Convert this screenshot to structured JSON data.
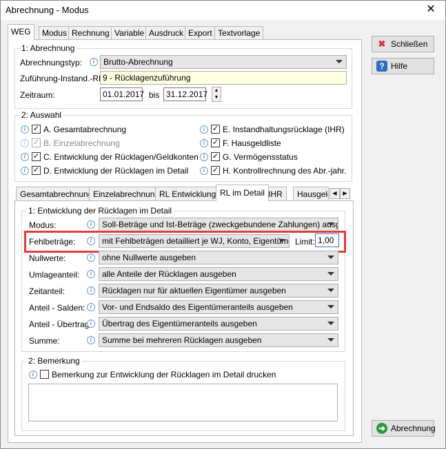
{
  "window": {
    "title": "Abrechnung - Modus",
    "close_glyph": "✕"
  },
  "main_tabs": [
    "WEG",
    "Modus",
    "Rechnung",
    "Variable",
    "Ausdruck",
    "Export",
    "Textvorlage"
  ],
  "group1": {
    "legend": "1: Abrechnung",
    "abrechnungstyp_label": "Abrechnungstyp:",
    "abrechnungstyp_value": "Brutto-Abrechnung",
    "zufuehrung_label": "Zuführung-Instand.-RL:",
    "zufuehrung_value": "9 - Rücklagenzuführung",
    "zeitraum_label": "Zeitraum:",
    "zeitraum_from": "01.01.2017",
    "zeitraum_bis": "bis",
    "zeitraum_to": "31.12.2017"
  },
  "group2": {
    "legend": "2: Auswahl",
    "items": [
      {
        "label": "A. Gesamtabrechnung",
        "checked": "✓"
      },
      {
        "label": "B. Einzelabrechnung",
        "checked": "✓"
      },
      {
        "label": "C. Entwicklung der Rücklagen/Geldkonten",
        "checked": "✓"
      },
      {
        "label": "D. Entwicklung der Rücklagen im Detail",
        "checked": "✓"
      },
      {
        "label": "E. Instandhaltungsrücklage (IHR)",
        "checked": "✓"
      },
      {
        "label": "F. Hausgeldliste",
        "checked": "✓"
      },
      {
        "label": "G. Vermögensstatus",
        "checked": "✓"
      },
      {
        "label": "H. Kontrollrechnung des Abr.-jahr.",
        "checked": "✓"
      }
    ]
  },
  "sub_tabs": [
    "Gesamtabrechnung",
    "Einzelabrechnung",
    "RL Entwicklung",
    "RL im Detail",
    "IHR",
    "Hausgeld"
  ],
  "detail": {
    "legend": "1: Entwicklung der Rücklagen im Detail",
    "rows": [
      {
        "label": "Modus:",
        "value": "Soll-Beträge und Ist-Beträge (zweckgebundene Zahlungen) ausgeben"
      },
      {
        "label": "Fehlbeträge:",
        "value": "mit Fehlbeträgen detailliert je WJ, Konto, Eigentümer"
      },
      {
        "label": "Nullwerte:",
        "value": "ohne Nullwerte ausgeben"
      },
      {
        "label": "Umlageanteil:",
        "value": "alle Anteile der Rücklagen ausgeben"
      },
      {
        "label": "Zeitanteil:",
        "value": "Rücklagen nur für aktuellen Eigentümer ausgeben"
      },
      {
        "label": "Anteil - Salden:",
        "value": "Vor- und Endsaldo des Eigentümeranteils ausgeben"
      },
      {
        "label": "Anteil - Übertrag:",
        "value": "Übertrag des Eigentümeranteils ausgeben"
      },
      {
        "label": "Summe:",
        "value": "Summe bei mehreren Rücklagen ausgeben"
      }
    ],
    "limit_label": "Limit:",
    "limit_value": "1,00"
  },
  "bemerkung": {
    "legend": "2: Bemerkung",
    "checkbox_label": "Bemerkung zur Entwicklung der Rücklagen im Detail drucken"
  },
  "buttons": {
    "schliessen": "Schließen",
    "hilfe": "Hilfe",
    "abrechnung": "Abrechnung"
  },
  "icons": {
    "info": "i",
    "close_button_icon": "✖",
    "help_button_icon": "?",
    "abrechnung_button_icon": "➜"
  },
  "colors": {
    "highlight": "#e53b3b",
    "yellow_field": "#ffffe1",
    "info_blue": "#3a72b7"
  }
}
